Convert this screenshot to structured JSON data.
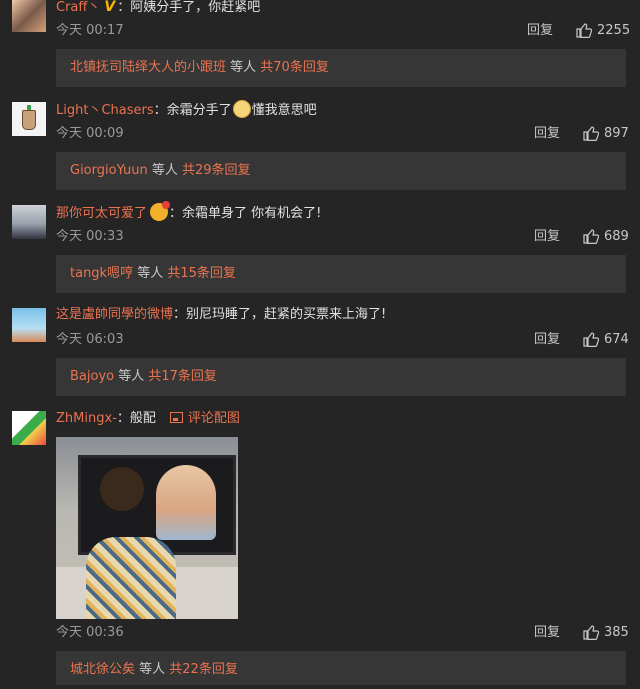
{
  "comments": [
    {
      "username": "Craff丶",
      "text": "：阿姨分手了，你赶紧吧",
      "time": "今天 00:17",
      "reply_label": "回复",
      "likes": "2255",
      "sub": {
        "users": "北镇抚司陆绎大人的小跟班",
        "middle": " 等人 ",
        "count": "共70条回复"
      }
    },
    {
      "username": "Light丶Chasers",
      "text_before": "：余霜分手了",
      "text_after": "懂我意思吧",
      "time": "今天 00:09",
      "reply_label": "回复",
      "likes": "897",
      "sub": {
        "users": "GiorgioYuun",
        "middle": " 等人 ",
        "count": "共29条回复"
      }
    },
    {
      "username": "那你可太可爱了",
      "text": "：余霜单身了 你有机会了!",
      "time": "今天 00:33",
      "reply_label": "回复",
      "likes": "689",
      "sub": {
        "users": "tangk嗯哼",
        "middle": " 等人 ",
        "count": "共15条回复"
      }
    },
    {
      "username": "这是盧帥同學的微博",
      "text": "：别尼玛睡了，赶紧的买票来上海了!",
      "time": "今天 06:03",
      "reply_label": "回复",
      "likes": "674",
      "sub": {
        "users": "Bajoyo",
        "middle": " 等人 ",
        "count": "共17条回复"
      }
    },
    {
      "username": "ZhMingx-",
      "text": "：般配",
      "image_link": "评论配图",
      "time": "今天 00:36",
      "reply_label": "回复",
      "likes": "385",
      "sub": {
        "users": "城北徐公矣",
        "middle": " 等人 ",
        "count": "共22条回复"
      }
    }
  ],
  "colors": {
    "accent": "#eb7350",
    "background": "#252525",
    "subbar": "#363636"
  },
  "icons": [
    "verified-v-icon",
    "cat-emoji-icon",
    "heart-face-emoji-icon",
    "picture-icon",
    "thumb-up-icon"
  ]
}
